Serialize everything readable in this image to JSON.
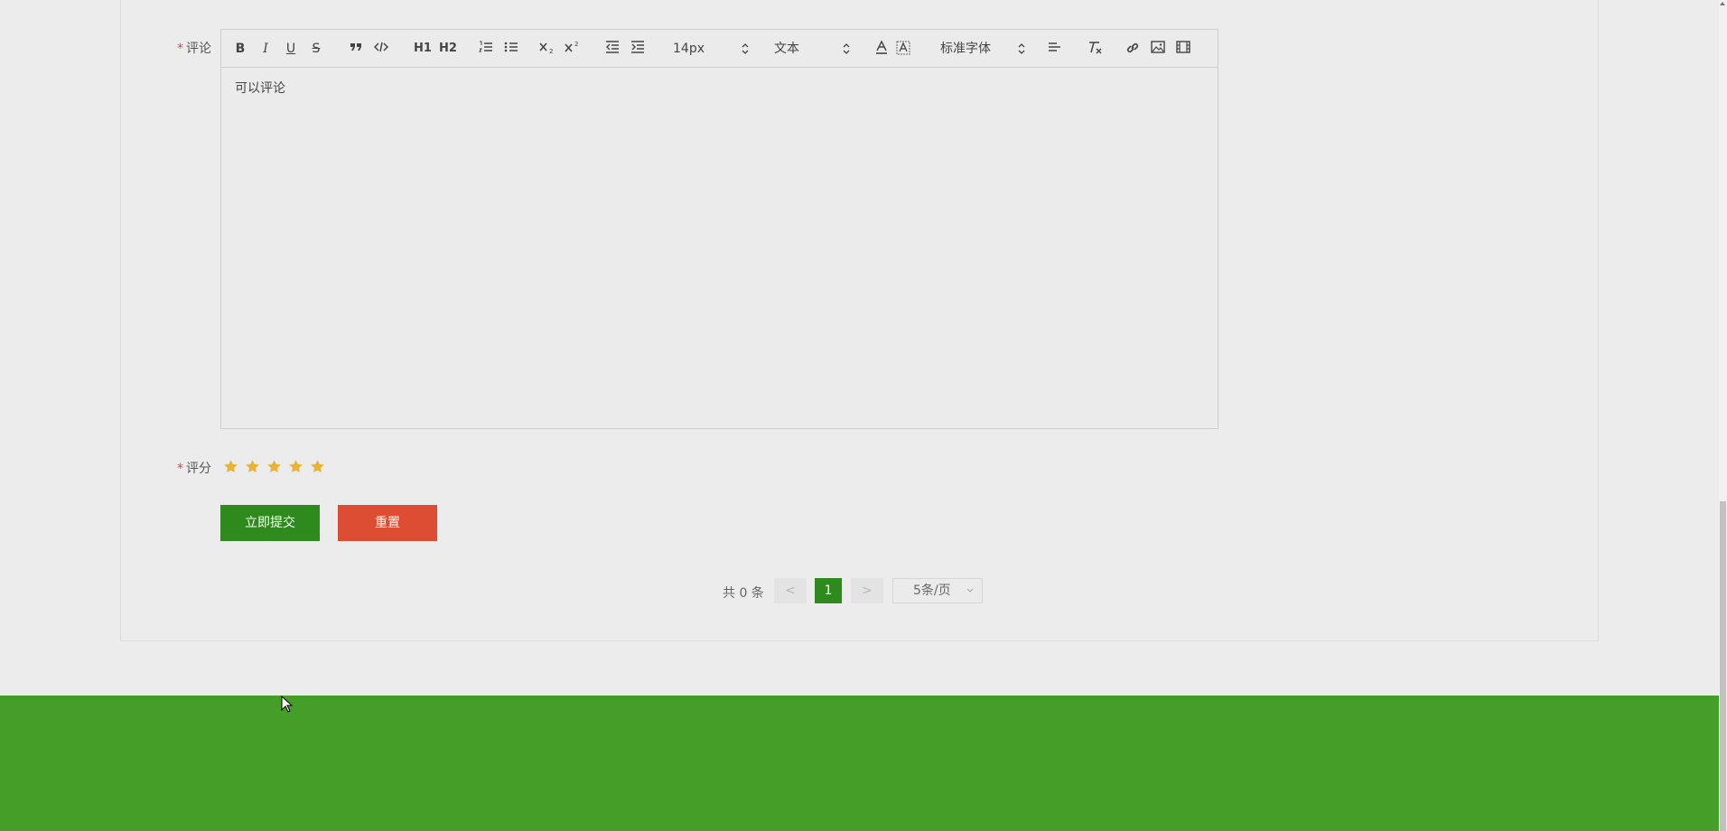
{
  "form": {
    "comment_label": "评论",
    "required_mark": "*",
    "rating_label": "评分",
    "rating_value": 5,
    "rating_max": 5,
    "star_color": "#e8b339"
  },
  "editor": {
    "content": "可以评论",
    "toolbar": {
      "bold_icon": "B",
      "italic_icon": "I",
      "underline_icon": "U",
      "strike_icon": "S",
      "h1": "H1",
      "h2": "H2",
      "font_size": "14px",
      "text_style": "文本",
      "font_family": "标准字体"
    }
  },
  "actions": {
    "submit_label": "立即提交",
    "reset_label": "重置",
    "submit_color": "#2f8a1e",
    "reset_color": "#dd4d33"
  },
  "pagination": {
    "total_text": "共 0 条",
    "prev": "<",
    "current_page": "1",
    "next": ">",
    "page_size": "5条/页"
  },
  "footer": {
    "color": "#449e28"
  }
}
